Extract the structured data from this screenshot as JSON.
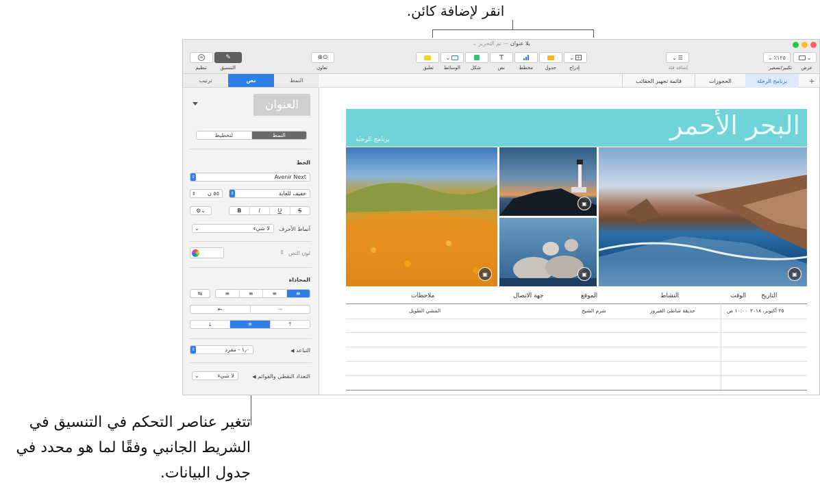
{
  "callouts": {
    "top": "انقر لإضافة كائن.",
    "bottom": "تتغير عناصر التحكم في التنسيق في الشريط الجانبي وفقًا لما هو محدد في جدول البيانات."
  },
  "window": {
    "title": "بلا عنوان",
    "title_status": "تم التحرير",
    "traffic_colors": {
      "close": "#fe5f57",
      "minimize": "#febc2e",
      "zoom": "#28c840"
    }
  },
  "toolbar": {
    "view_label": "عرض",
    "zoom_label": "تكبير/تصغير",
    "zoom_value": "٪١٢٥",
    "add_category_label": "إضافة فئة",
    "insert_label": "إدراج",
    "table_label": "جدول",
    "chart_label": "مخطط",
    "text_label": "نص",
    "shape_label": "شكل",
    "media_label": "الوسائط",
    "comment_label": "تعليق",
    "collaborate_label": "تعاون",
    "format_label": "التنسيق",
    "organize_label": "تنظيم",
    "accent": "#2e80e8"
  },
  "sidebar": {
    "tabs": {
      "style": "النمط",
      "text": "نص",
      "arrange": "ترتيب"
    },
    "title_style": "العنوان",
    "style_toggle": {
      "style": "النمط",
      "layout": "لتخطيط"
    },
    "font_heading": "الخط",
    "font_name": "Avenir Next",
    "font_weight": "خفيف للغاية",
    "font_size": "٥٥ ن",
    "bold": "B",
    "italic": "I",
    "underline": "U",
    "strike": "S",
    "char_styles_label": "أنماط الأحرف",
    "char_styles_value": "لا شيء",
    "text_color_label": "لون النص",
    "alignment_heading": "المحاذاة",
    "spacing_label": "التباعد",
    "spacing_value": "١٫٠ - مفرد",
    "bullets_label": "التعداد النقطي والقوائم",
    "bullets_value": "لا شيء"
  },
  "sheets": {
    "add": "+",
    "tabs": [
      "برنامج الرحلة",
      "الحجوزات",
      "قائمة تجهيز الحقائب"
    ]
  },
  "doc": {
    "banner_title": "البحر الأحمر",
    "banner_subtitle": "برنامج الرحلة",
    "table_headers": [
      "التاريخ",
      "الوقت",
      "النشاط",
      "الموقع",
      "جهة الاتصال",
      "ملاحظات"
    ],
    "rows": [
      [
        "٢٥ أكتوبر، ٢٠١٨",
        "١٠:٠٠ ص",
        "حديقة شاطئ الفيروز",
        "شرم الشيخ",
        "",
        "المشي الطويل"
      ]
    ]
  }
}
